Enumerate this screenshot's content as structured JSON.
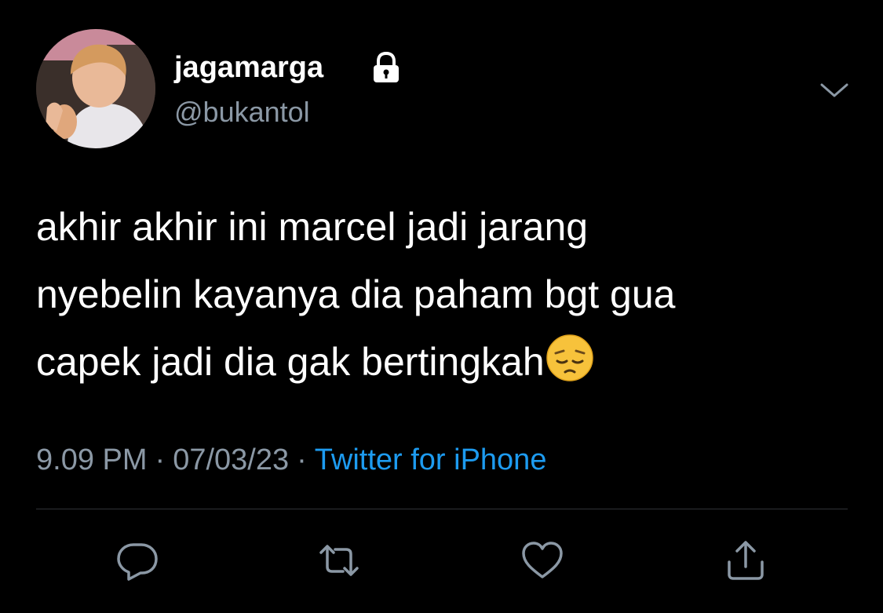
{
  "user": {
    "display_name": "jagamarga",
    "handle": "@bukantol",
    "protected_icon": "lock-icon",
    "avatar_icon": "profile-photo"
  },
  "tweet": {
    "lines": [
      "akhir akhir ini marcel jadi jarang",
      "nyebelin kayanya dia paham bgt gua",
      "capek jadi dia gak bertingkah"
    ],
    "emoji": "pensive-face-emoji"
  },
  "meta": {
    "time": "9.09 PM",
    "separator": "·",
    "date": "07/03/23",
    "source": "Twitter for iPhone"
  },
  "actions": {
    "reply_icon": "reply-icon",
    "retweet_icon": "retweet-icon",
    "like_icon": "heart-icon",
    "share_icon": "share-icon"
  },
  "colors": {
    "background": "#000000",
    "text": "#ffffff",
    "secondary": "#8b98a5",
    "link": "#1d9bf0",
    "divider": "#2f3336"
  }
}
